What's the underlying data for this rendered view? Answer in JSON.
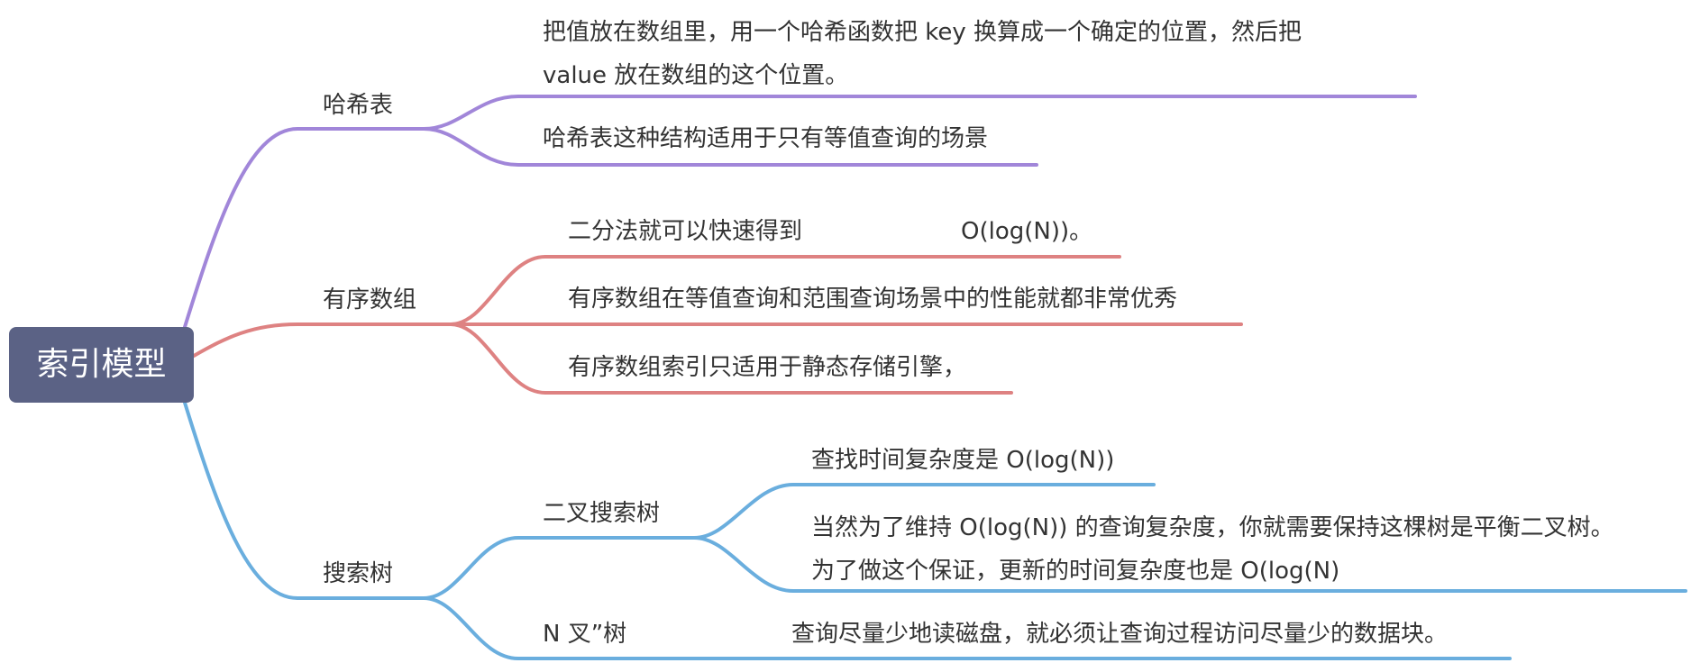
{
  "root": {
    "label": "索引模型"
  },
  "colors": {
    "root_fill": "#5b6285",
    "hash_branch": "#a186d9",
    "array_branch": "#de8282",
    "tree_branch": "#6aaede"
  },
  "branches": {
    "hash": {
      "label": "哈希表",
      "items": [
        "把值放在数组里，用一个哈希函数把 key 换算成一个确定的位置，然后把 value 放在数组的这个位置。",
        "哈希表这种结构适用于只有等值查询的场景"
      ]
    },
    "sorted_array": {
      "label": "有序数组",
      "items": [
        {
          "text": "二分法就可以快速得到",
          "value": "O(log(N))。"
        },
        "有序数组在等值查询和范围查询场景中的性能就都非常优秀",
        "有序数组索引只适用于静态存储引擎，"
      ]
    },
    "search_tree": {
      "label": "搜索树",
      "binary": {
        "label": "二叉搜索树",
        "items": [
          "查找时间复杂度是 O(log(N))",
          "当然为了维持 O(log(N)) 的查询复杂度，你就需要保持这棵树是平衡二叉树。为了做这个保证，更新的时间复杂度也是 O(log(N)"
        ]
      },
      "nary": {
        "label": "N 叉”树",
        "items": [
          "查询尽量少地读磁盘，就必须让查询过程访问尽量少的数据块。"
        ]
      }
    }
  }
}
